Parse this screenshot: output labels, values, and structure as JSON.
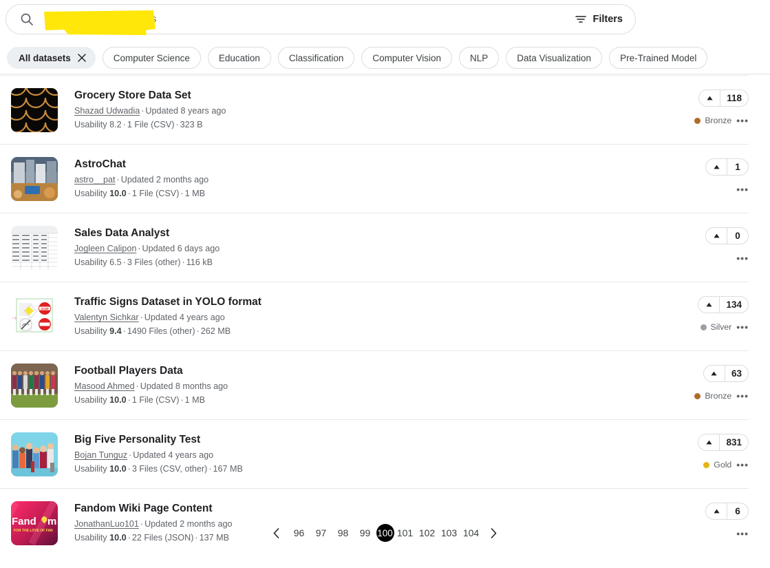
{
  "search": {
    "placeholder": "Search 361,880 datasets",
    "value": "",
    "icon": "search-icon",
    "filters_label": "Filters",
    "filters_icon": "filter-icon",
    "highlight_color": "#ffe70a"
  },
  "chips": [
    {
      "label": "All datasets",
      "active": true,
      "close_icon": "close-icon"
    },
    {
      "label": "Computer Science",
      "active": false
    },
    {
      "label": "Education",
      "active": false
    },
    {
      "label": "Classification",
      "active": false
    },
    {
      "label": "Computer Vision",
      "active": false
    },
    {
      "label": "NLP",
      "active": false
    },
    {
      "label": "Data Visualization",
      "active": false
    },
    {
      "label": "Pre-Trained Model",
      "active": false
    }
  ],
  "results": [
    {
      "title": "Grocery Store Data Set",
      "author": "Shazad Udwadia",
      "updated": "Updated 8 years ago",
      "usability_label": "Usability",
      "usability": "8.2",
      "usability_bold": false,
      "files": "1 File (CSV)",
      "size": "323 B",
      "votes": "118",
      "medal": "Bronze",
      "medal_color": "#b06c26",
      "thumb": "grocery-scallop-thumbnail"
    },
    {
      "title": "AstroChat",
      "author": "astro__pat",
      "updated": "Updated 2 months ago",
      "usability_label": "Usability",
      "usability": "10.0",
      "usability_bold": true,
      "files": "1 File (CSV)",
      "size": "1 MB",
      "votes": "1",
      "medal": null,
      "medal_color": null,
      "thumb": "astro-photo-thumbnail"
    },
    {
      "title": "Sales Data Analyst",
      "author": "Jogleen Calipon",
      "updated": "Updated 6 days ago",
      "usability_label": "Usability",
      "usability": "6.5",
      "usability_bold": false,
      "files": "3 Files (other)",
      "size": "116 kB",
      "votes": "0",
      "medal": null,
      "medal_color": null,
      "thumb": "spreadsheet-thumbnail"
    },
    {
      "title": "Traffic Signs Dataset in YOLO format",
      "author": "Valentyn Sichkar",
      "updated": "Updated 4 years ago",
      "usability_label": "Usability",
      "usability": "9.4",
      "usability_bold": true,
      "files": "1490 Files (other)",
      "size": "262 MB",
      "votes": "134",
      "medal": "Silver",
      "medal_color": "#9aa0a6",
      "thumb": "traffic-signs-thumbnail"
    },
    {
      "title": "Football Players Data",
      "author": "Masood Ahmed",
      "updated": "Updated 8 months ago",
      "usability_label": "Usability",
      "usability": "10.0",
      "usability_bold": true,
      "files": "1 File (CSV)",
      "size": "1 MB",
      "votes": "63",
      "medal": "Bronze",
      "medal_color": "#b06c26",
      "thumb": "football-players-thumbnail"
    },
    {
      "title": "Big Five Personality Test",
      "author": "Bojan Tunguz",
      "updated": "Updated 4 years ago",
      "usability_label": "Usability",
      "usability": "10.0",
      "usability_bold": true,
      "files": "3 Files (CSV, other)",
      "size": "167 MB",
      "votes": "831",
      "medal": "Gold",
      "medal_color": "#e1b419",
      "thumb": "people-group-thumbnail"
    },
    {
      "title": "Fandom Wiki Page Content",
      "author": "JonathanLuo101",
      "updated": "Updated 2 months ago",
      "usability_label": "Usability",
      "usability": "10.0",
      "usability_bold": true,
      "files": "22 Files (JSON)",
      "size": "137 MB",
      "votes": "6",
      "medal": null,
      "medal_color": null,
      "thumb": "fandom-logo-thumbnail"
    }
  ],
  "pagination": {
    "prev_icon": "chevron-left-icon",
    "next_icon": "chevron-right-icon",
    "pages": [
      "96",
      "97",
      "98",
      "99",
      "100",
      "101",
      "102",
      "103",
      "104"
    ],
    "current": "100"
  },
  "kebab_label": "•••"
}
